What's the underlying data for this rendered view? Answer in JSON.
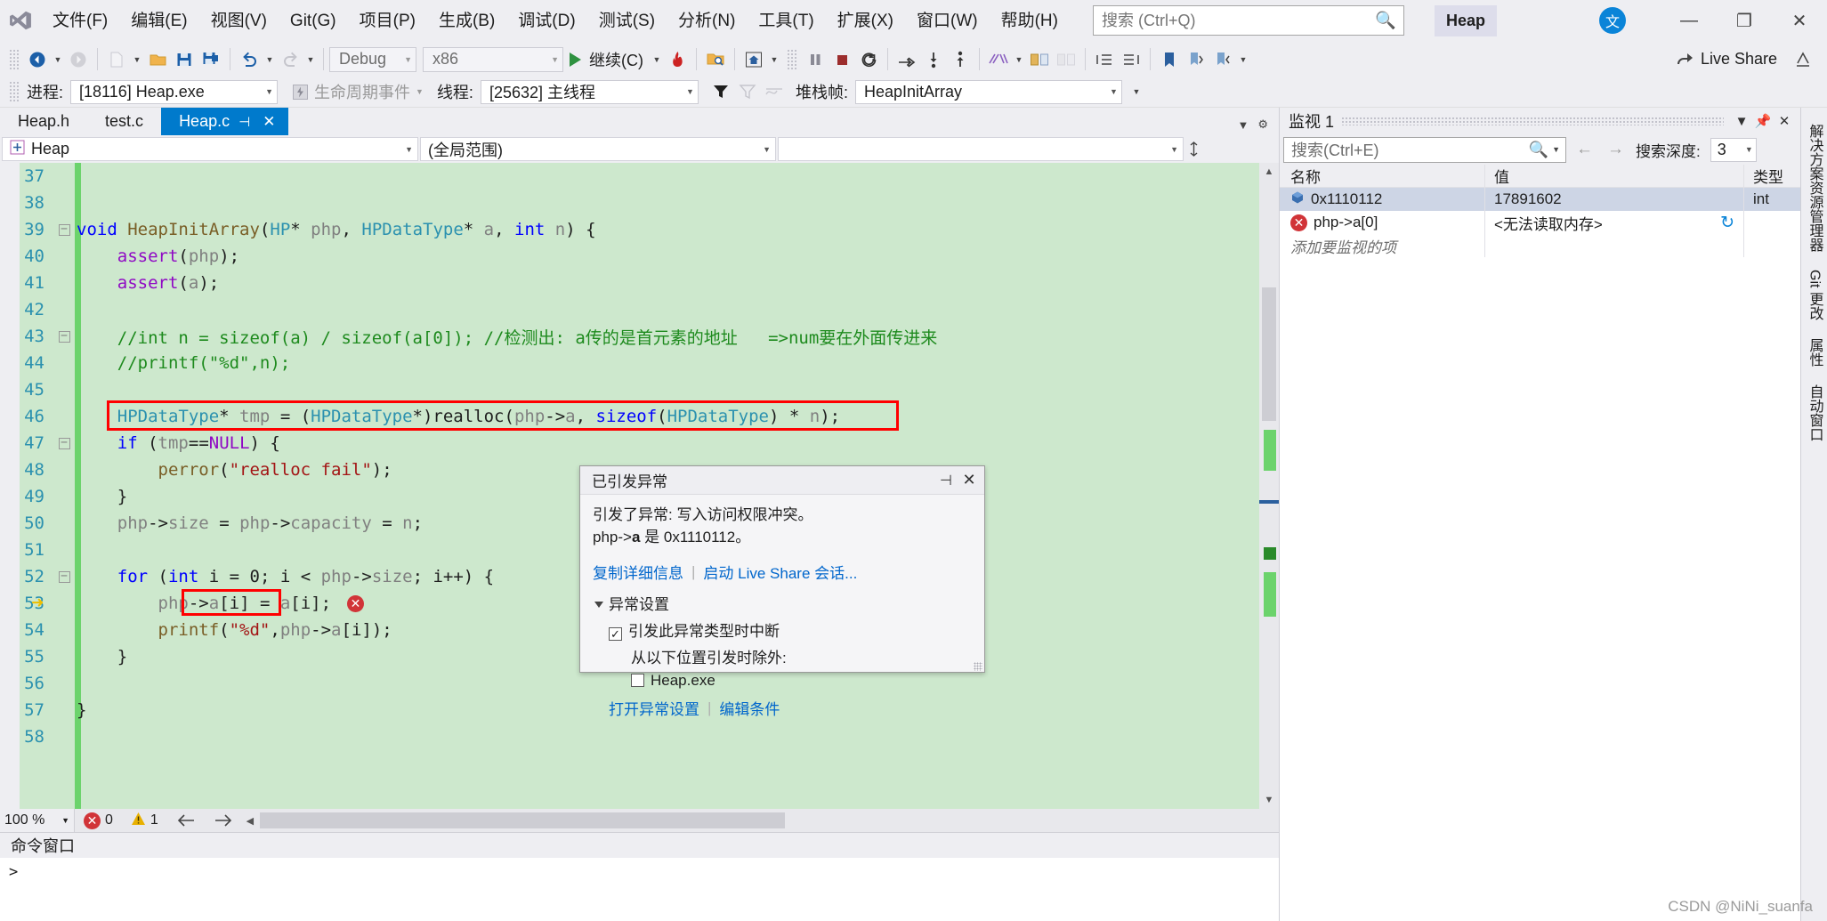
{
  "menubar": {
    "logo": "vs-logo",
    "items": [
      "文件(F)",
      "编辑(E)",
      "视图(V)",
      "Git(G)",
      "项目(P)",
      "生成(B)",
      "调试(D)",
      "测试(S)",
      "分析(N)",
      "工具(T)",
      "扩展(X)",
      "窗口(W)",
      "帮助(H)"
    ],
    "search_placeholder": "搜索 (Ctrl+Q)",
    "search_icon": "search-icon",
    "solution_badge": "Heap",
    "ime_badge": "文",
    "window_buttons": {
      "minimize": "—",
      "maximize": "❐",
      "close": "✕"
    }
  },
  "toolbar": {
    "config": "Debug",
    "platform": "x86",
    "continue_label": "继续(C)",
    "live_share_label": "Live Share",
    "icons": [
      "nav-back-icon",
      "nav-forward-icon",
      "new-file-icon",
      "open-file-icon",
      "save-icon",
      "save-all-icon",
      "undo-icon",
      "redo-icon",
      "start-debug-icon",
      "hot-reload-icon",
      "attach-process-icon",
      "home-icon",
      "pause-icon",
      "stop-icon",
      "restart-icon",
      "step-over-icon",
      "step-into-icon",
      "step-out-icon",
      "intellicode-icon",
      "window-layout-icon",
      "compare-icon",
      "indent-icon",
      "outdent-icon",
      "bookmark-icon",
      "bookmark-prev-icon",
      "bookmark-next-icon"
    ]
  },
  "debugbar": {
    "process_label": "进程:",
    "process_value": "[18116] Heap.exe",
    "lifecycle_label": "生命周期事件",
    "thread_label": "线程:",
    "thread_value": "[25632] 主线程",
    "frame_label": "堆栈帧:",
    "frame_value": "HeapInitArray",
    "filter_icons": [
      "filter-icon",
      "filter-clear-icon",
      "flatten-icon"
    ]
  },
  "editor": {
    "tabs": [
      {
        "label": "Heap.h",
        "active": false
      },
      {
        "label": "test.c",
        "active": false
      },
      {
        "label": "Heap.c",
        "active": true,
        "pin": "📌",
        "close": "✕"
      }
    ],
    "nav": {
      "project": "Heap",
      "scope": "(全局范围)",
      "member": ""
    },
    "first_line": 37,
    "lines": [
      {
        "n": 37,
        "fold": "",
        "exec": false,
        "tokens": []
      },
      {
        "n": 38,
        "fold": "",
        "exec": false,
        "tokens": []
      },
      {
        "n": 39,
        "fold": "minus",
        "exec": false,
        "tokens": [
          {
            "t": "void ",
            "c": "k"
          },
          {
            "t": "HeapInitArray",
            "c": "fn"
          },
          {
            "t": "(",
            "c": "pl"
          },
          {
            "t": "HP",
            "c": "ty"
          },
          {
            "t": "* ",
            "c": "pl"
          },
          {
            "t": "php",
            "c": "id"
          },
          {
            "t": ", ",
            "c": "pl"
          },
          {
            "t": "HPDataType",
            "c": "ty"
          },
          {
            "t": "* ",
            "c": "pl"
          },
          {
            "t": "a",
            "c": "id"
          },
          {
            "t": ", ",
            "c": "pl"
          },
          {
            "t": "int ",
            "c": "k"
          },
          {
            "t": "n",
            "c": "id"
          },
          {
            "t": ") {",
            "c": "pl"
          }
        ]
      },
      {
        "n": 40,
        "fold": "",
        "exec": false,
        "indent": 1,
        "tokens": [
          {
            "t": "assert",
            "c": "pp"
          },
          {
            "t": "(",
            "c": "pl"
          },
          {
            "t": "php",
            "c": "id"
          },
          {
            "t": ");",
            "c": "pl"
          }
        ]
      },
      {
        "n": 41,
        "fold": "",
        "exec": false,
        "indent": 1,
        "tokens": [
          {
            "t": "assert",
            "c": "pp"
          },
          {
            "t": "(",
            "c": "pl"
          },
          {
            "t": "a",
            "c": "id"
          },
          {
            "t": ");",
            "c": "pl"
          }
        ]
      },
      {
        "n": 42,
        "fold": "",
        "exec": false,
        "tokens": []
      },
      {
        "n": 43,
        "fold": "minus",
        "exec": false,
        "indent": 1,
        "tokens": [
          {
            "t": "//int n = sizeof(a) / sizeof(a[0]); //检测出: a传的是首元素的地址   =>num要在外面传进来",
            "c": "cm"
          }
        ]
      },
      {
        "n": 44,
        "fold": "",
        "exec": false,
        "indent": 1,
        "tokens": [
          {
            "t": "//printf(\"%d\",n);",
            "c": "cm"
          }
        ]
      },
      {
        "n": 45,
        "fold": "",
        "exec": false,
        "tokens": []
      },
      {
        "n": 46,
        "fold": "",
        "exec": false,
        "indent": 1,
        "highlight": true,
        "tokens": [
          {
            "t": "HPDataType",
            "c": "ty"
          },
          {
            "t": "* ",
            "c": "pl"
          },
          {
            "t": "tmp",
            "c": "id"
          },
          {
            "t": " = (",
            "c": "pl"
          },
          {
            "t": "HPDataType",
            "c": "ty"
          },
          {
            "t": "*)",
            "c": "pl"
          },
          {
            "t": "realloc",
            "c": "pl"
          },
          {
            "t": "(",
            "c": "pl"
          },
          {
            "t": "php",
            "c": "id"
          },
          {
            "t": "->",
            "c": "pl"
          },
          {
            "t": "a",
            "c": "id"
          },
          {
            "t": ", ",
            "c": "pl"
          },
          {
            "t": "sizeof",
            "c": "k"
          },
          {
            "t": "(",
            "c": "pl"
          },
          {
            "t": "HPDataType",
            "c": "ty"
          },
          {
            "t": ") * ",
            "c": "pl"
          },
          {
            "t": "n",
            "c": "id"
          },
          {
            "t": ");",
            "c": "pl"
          }
        ]
      },
      {
        "n": 47,
        "fold": "minus",
        "exec": false,
        "indent": 1,
        "tokens": [
          {
            "t": "if",
            "c": "k"
          },
          {
            "t": " (",
            "c": "pl"
          },
          {
            "t": "tmp",
            "c": "id"
          },
          {
            "t": "==",
            "c": "pl"
          },
          {
            "t": "NULL",
            "c": "pp"
          },
          {
            "t": ") {",
            "c": "pl"
          }
        ]
      },
      {
        "n": 48,
        "fold": "",
        "exec": false,
        "indent": 2,
        "tokens": [
          {
            "t": "perror",
            "c": "fn"
          },
          {
            "t": "(",
            "c": "pl"
          },
          {
            "t": "\"realloc fail\"",
            "c": "st"
          },
          {
            "t": ");",
            "c": "pl"
          }
        ]
      },
      {
        "n": 49,
        "fold": "",
        "exec": false,
        "indent": 1,
        "tokens": [
          {
            "t": "}",
            "c": "pl"
          }
        ]
      },
      {
        "n": 50,
        "fold": "",
        "exec": false,
        "indent": 1,
        "tokens": [
          {
            "t": "php",
            "c": "id"
          },
          {
            "t": "->",
            "c": "pl"
          },
          {
            "t": "size",
            "c": "id"
          },
          {
            "t": " = ",
            "c": "pl"
          },
          {
            "t": "php",
            "c": "id"
          },
          {
            "t": "->",
            "c": "pl"
          },
          {
            "t": "capacity",
            "c": "id"
          },
          {
            "t": " = ",
            "c": "pl"
          },
          {
            "t": "n",
            "c": "id"
          },
          {
            "t": ";",
            "c": "pl"
          }
        ]
      },
      {
        "n": 51,
        "fold": "",
        "exec": false,
        "tokens": []
      },
      {
        "n": 52,
        "fold": "minus",
        "exec": false,
        "indent": 1,
        "tokens": [
          {
            "t": "for",
            "c": "k"
          },
          {
            "t": " (",
            "c": "pl"
          },
          {
            "t": "int",
            "c": "k"
          },
          {
            "t": " i = ",
            "c": "pl"
          },
          {
            "t": "0",
            "c": "num"
          },
          {
            "t": "; i < ",
            "c": "pl"
          },
          {
            "t": "php",
            "c": "id"
          },
          {
            "t": "->",
            "c": "pl"
          },
          {
            "t": "size",
            "c": "id"
          },
          {
            "t": "; i++) {",
            "c": "pl"
          }
        ]
      },
      {
        "n": 53,
        "fold": "",
        "exec": true,
        "indent": 2,
        "error": true,
        "error_box": true,
        "tokens": [
          {
            "t": "php",
            "c": "id"
          },
          {
            "t": "->",
            "c": "pl"
          },
          {
            "t": "a",
            "c": "id"
          },
          {
            "t": "[i] = ",
            "c": "pl"
          },
          {
            "t": "a",
            "c": "id"
          },
          {
            "t": "[i];",
            "c": "pl"
          }
        ]
      },
      {
        "n": 54,
        "fold": "",
        "exec": false,
        "indent": 2,
        "tokens": [
          {
            "t": "printf",
            "c": "fn"
          },
          {
            "t": "(",
            "c": "pl"
          },
          {
            "t": "\"%d\"",
            "c": "st"
          },
          {
            "t": ",",
            "c": "pl"
          },
          {
            "t": "php",
            "c": "id"
          },
          {
            "t": "->",
            "c": "pl"
          },
          {
            "t": "a",
            "c": "id"
          },
          {
            "t": "[i]);",
            "c": "pl"
          }
        ]
      },
      {
        "n": 55,
        "fold": "",
        "exec": false,
        "indent": 1,
        "tokens": [
          {
            "t": "}",
            "c": "pl"
          }
        ]
      },
      {
        "n": 56,
        "fold": "",
        "exec": false,
        "tokens": []
      },
      {
        "n": 57,
        "fold": "",
        "exec": false,
        "tokens": [
          {
            "t": "}",
            "c": "pl"
          }
        ]
      },
      {
        "n": 58,
        "fold": "",
        "exec": false,
        "tokens": []
      }
    ],
    "status": {
      "zoom": "100 %",
      "errors": "0",
      "warnings": "1",
      "error_icon": "error-icon",
      "warning_icon": "warning-icon",
      "prev_icon": "arrow-left-icon",
      "next_icon": "arrow-right-icon"
    }
  },
  "command_window": {
    "title": "命令窗口",
    "prompt": ">"
  },
  "watch": {
    "title": "监视 1",
    "header_buttons": [
      "chevron-down-icon",
      "pin-icon",
      "close-icon"
    ],
    "search_placeholder": "搜索(Ctrl+E)",
    "search_icon": "search-icon",
    "depth_label": "搜索深度:",
    "depth_value": "3",
    "columns": [
      "名称",
      "值",
      "类型"
    ],
    "rows": [
      {
        "icon": "hex-cube-icon",
        "name": "0x1110112",
        "value": "17891602",
        "type": "int",
        "selected": true
      },
      {
        "icon": "error-circle-icon",
        "name": "php->a[0]",
        "value": "<无法读取内存>",
        "type": "",
        "refresh": "refresh-icon",
        "selected": false
      }
    ],
    "add_placeholder": "添加要监视的项"
  },
  "right_vtabs": [
    "解决方案资源管理器",
    "Git 更改",
    "属性",
    "自动窗口"
  ],
  "exception_dialog": {
    "title": "已引发异常",
    "pin_icon": "pin-icon",
    "close_icon": "close-icon",
    "message_line1": "引发了异常: 写入访问权限冲突。",
    "message_line2_prefix": "php->",
    "message_line2_bold": "a",
    "message_line2_suffix": " 是 0x1110112。",
    "links": [
      "复制详细信息",
      "启动 Live Share 会话..."
    ],
    "settings_title": "异常设置",
    "break_checkbox_label": "引发此异常类型时中断",
    "break_checked": true,
    "except_from_label": "从以下位置引发时除外:",
    "module_label": "Heap.exe",
    "module_checked": false,
    "bottom_links": [
      "打开异常设置",
      "编辑条件"
    ]
  },
  "watermark": "CSDN @NiNi_suanfa",
  "colors": {
    "accent": "#007acc",
    "highlight_box": "#ff0000",
    "code_bg": "#cde8cd",
    "exec_line": "#f0c000",
    "chrome": "#eeeef2"
  }
}
